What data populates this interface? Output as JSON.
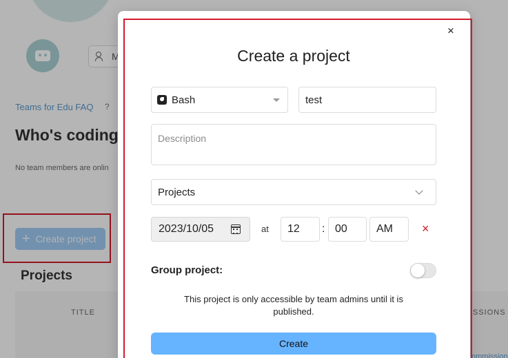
{
  "background": {
    "members_label": "M",
    "faq_link": "Teams for Edu FAQ",
    "faq_help": "?",
    "heading": "Who's coding",
    "online_status": "No team members are onlin",
    "create_project_label": "Create project",
    "projects_heading": "Projects",
    "table_headers": [
      "TITLE",
      "SSIONS"
    ],
    "bottom_link": "ommission"
  },
  "modal": {
    "close_label": "×",
    "title": "Create a project",
    "language": {
      "selected": "Bash",
      "icon": "bash-icon"
    },
    "name_value": "test",
    "description_placeholder": "Description",
    "folder_selected": "Projects",
    "date_value": "2023/10/05",
    "at_label": "at",
    "hour_value": "12",
    "time_separator": ":",
    "minute_value": "00",
    "ampm_value": "AM",
    "clear_label": "×",
    "group_project_label": "Group project:",
    "group_project_enabled": false,
    "notice": "This project is only accessible by team admins until it is published.",
    "create_button": "Create"
  },
  "colors": {
    "highlight": "#d0192a",
    "primary_button": "#66b3ff",
    "link": "#5a98c9"
  }
}
